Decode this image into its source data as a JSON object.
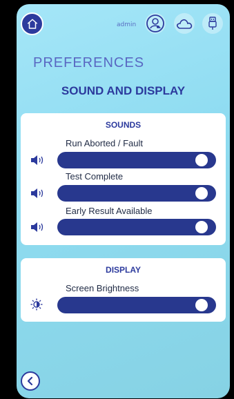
{
  "header": {
    "user": "admin",
    "icons": [
      "home-icon",
      "user-icon",
      "cloud-icon",
      "usb-icon"
    ]
  },
  "page": {
    "section_title": "PREFERENCES",
    "subtitle": "SOUND AND DISPLAY"
  },
  "sounds": {
    "title": "SOUNDS",
    "items": [
      {
        "label": "Run Aborted / Fault",
        "icon": "speaker-icon",
        "level": 1.0
      },
      {
        "label": "Test Complete",
        "icon": "speaker-icon",
        "level": 1.0
      },
      {
        "label": "Early Result Available",
        "icon": "speaker-icon",
        "level": 1.0
      }
    ]
  },
  "display": {
    "title": "DISPLAY",
    "items": [
      {
        "label": "Screen Brightness",
        "icon": "brightness-icon",
        "level": 1.0
      }
    ]
  },
  "footer": {
    "back_icon": "back-icon"
  },
  "colors": {
    "primary": "#2c3a9d",
    "slider": "#28388e",
    "background": "#8fdcf1"
  }
}
